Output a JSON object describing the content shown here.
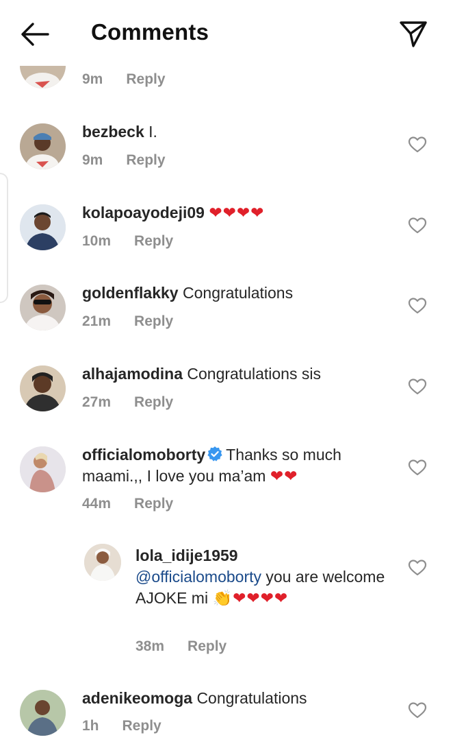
{
  "header": {
    "title": "Comments",
    "back_icon": "arrow-left-icon",
    "share_icon": "paper-plane-icon"
  },
  "colors": {
    "heart": "#e0202a",
    "verified": "#3897f0",
    "meta_gray": "#8e8e8e",
    "mention": "#1a4a8a"
  },
  "comments": [
    {
      "username": "",
      "text": "",
      "time": "9m",
      "reply": "Reply"
    },
    {
      "username": "bezbeck",
      "text": "I.",
      "time": "9m",
      "reply": "Reply"
    },
    {
      "username": "kolapoayodeji09",
      "text": "❤❤❤❤",
      "time": "10m",
      "reply": "Reply"
    },
    {
      "username": "goldenflakky",
      "text": "Congratulations",
      "time": "21m",
      "reply": "Reply"
    },
    {
      "username": "alhajamodina",
      "text": "Congratulations sis",
      "time": "27m",
      "reply": "Reply"
    },
    {
      "username": "officialomoborty",
      "verified": true,
      "text": "Thanks so much maami.,, I love you ma’am",
      "emoji": "❤❤",
      "time": "44m",
      "reply": "Reply"
    },
    {
      "username": "lola_idije1959",
      "mention": "@officialomoborty",
      "text": "you are welcome AJOKE mi",
      "emoji": "👏❤❤❤❤",
      "time": "38m",
      "reply": "Reply"
    },
    {
      "username": "adenikeomoga",
      "text": "Congratulations",
      "time": "1h",
      "reply": "Reply"
    }
  ]
}
